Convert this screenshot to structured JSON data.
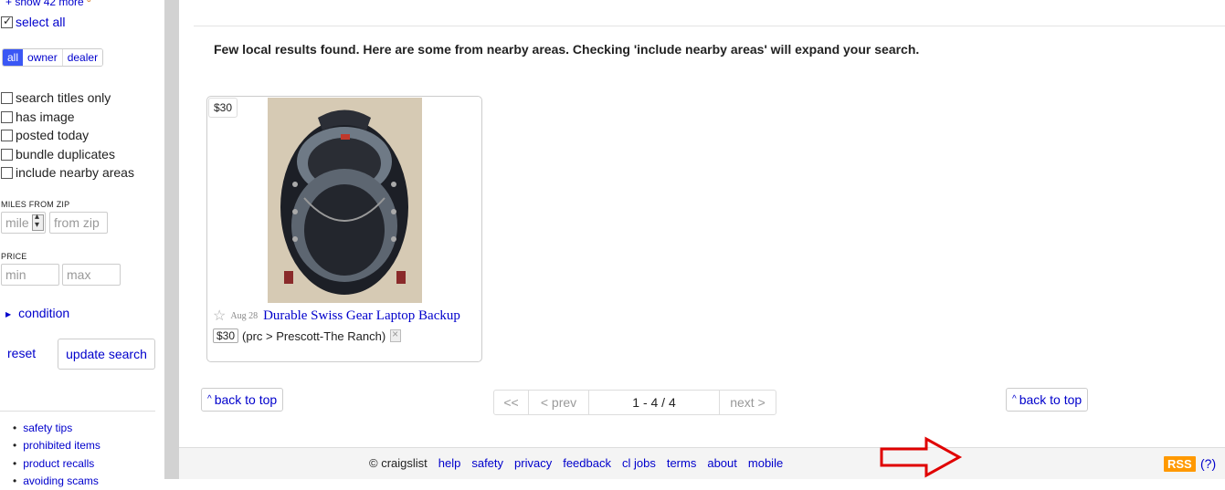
{
  "sidebar": {
    "show_more": "show 42 more",
    "show_more_count": "0",
    "select_all": "select all",
    "seller_types": [
      "all",
      "owner",
      "dealer"
    ],
    "options": [
      {
        "label": "search titles only",
        "checked": false
      },
      {
        "label": "has image",
        "checked": false
      },
      {
        "label": "posted today",
        "checked": false
      },
      {
        "label": "bundle duplicates",
        "checked": false
      },
      {
        "label": "include nearby areas",
        "checked": false
      }
    ],
    "miles_label": "MILES FROM ZIP",
    "miles_placeholder": "mile",
    "zip_placeholder": "from zip",
    "price_label": "PRICE",
    "min_placeholder": "min",
    "max_placeholder": "max",
    "condition": "condition",
    "reset": "reset",
    "update_search": "update search",
    "links": [
      "safety tips",
      "prohibited items",
      "product recalls",
      "avoiding scams"
    ]
  },
  "main": {
    "notice": "Few local results found. Here are some from nearby areas. Checking 'include nearby areas' will expand your search.",
    "listing": {
      "price": "$30",
      "date": "Aug 28",
      "title": "Durable Swiss Gear Laptop Backup",
      "location": "(prc > Prescott-The Ranch)"
    },
    "back_to_top": "back to top",
    "pager": {
      "first": "<<",
      "prev": "< prev",
      "range": "1 - 4 / 4",
      "next": "next >"
    }
  },
  "footer": {
    "copyright": "© craigslist",
    "links": [
      "help",
      "safety",
      "privacy",
      "feedback",
      "cl jobs",
      "terms",
      "about",
      "mobile"
    ],
    "rss": "RSS",
    "rss_help": "(?)"
  },
  "colors": {
    "link": "#0000cc",
    "rss": "#ff9900",
    "arrow": "#e00000",
    "segment_active": "#3a57f5"
  }
}
